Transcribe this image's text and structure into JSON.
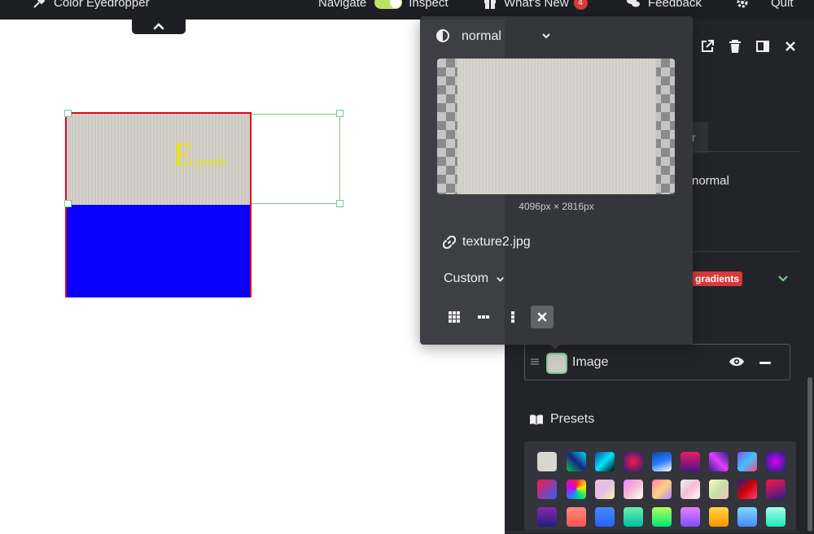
{
  "topbar": {
    "eyedropper_label": "Color Eyedropper",
    "navigate_label": "Navigate",
    "inspect_label": "Inspect",
    "whats_new_label": "What's New",
    "whats_new_count": "4",
    "feedback_label": "Feedback",
    "quit_label": "Quit"
  },
  "canvas": {
    "example_first": "E",
    "example_rest": "xample",
    "example_color": "#f0e400",
    "shape_border_color": "#e2001c",
    "fill_color": "#0a00ff"
  },
  "popup": {
    "blend_mode": "normal",
    "image_dims": "4096px × 2816px",
    "file_name": "texture2.jpg",
    "size_mode": "Custom"
  },
  "panel": {
    "partial_tab": "r",
    "blend_mode": "normal",
    "gradients_badge": "gradients",
    "layer_label": "Image",
    "presets_title": "Presets"
  },
  "icons": {
    "eyedropper": "eyedropper-icon",
    "gift": "gift-icon",
    "feedback": "chat-bubbles-icon",
    "settings": "gear-icon",
    "blend": "blend-mode-icon",
    "link": "link-icon",
    "tile_grid": "tile-grid-icon",
    "tile_x": "tile-x-icon",
    "tile_y": "tile-y-icon",
    "close": "close-icon",
    "external": "external-link-icon",
    "trash": "trash-icon",
    "panel_toggle": "panel-toggle-icon",
    "eye": "eye-icon",
    "book": "book-icon"
  }
}
